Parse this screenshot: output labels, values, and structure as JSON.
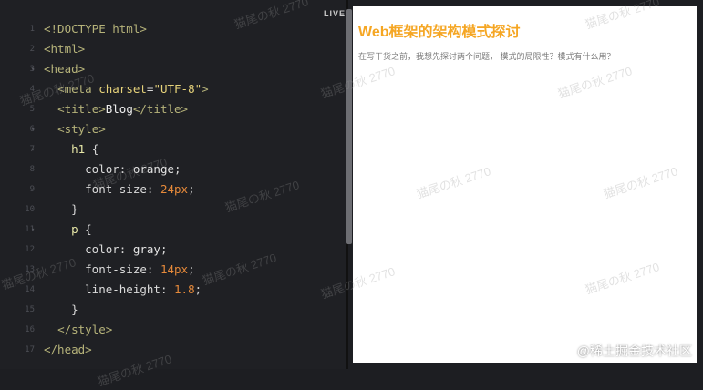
{
  "editor": {
    "live_label": "LIVE",
    "lines": [
      {
        "n": "1",
        "fold": "",
        "parts": [
          [
            "tag",
            "<!DOCTYPE html>"
          ]
        ]
      },
      {
        "n": "2",
        "fold": "",
        "parts": [
          [
            "tag",
            "<html>"
          ]
        ]
      },
      {
        "n": "3",
        "fold": "▾",
        "parts": [
          [
            "tag",
            "<head>"
          ]
        ]
      },
      {
        "n": "4",
        "fold": "",
        "parts": [
          [
            "txt",
            "  "
          ],
          [
            "tag",
            "<meta "
          ],
          [
            "attr",
            "charset"
          ],
          [
            "pun",
            "="
          ],
          [
            "str",
            "\"UTF-8\""
          ],
          [
            "tag",
            ">"
          ]
        ]
      },
      {
        "n": "5",
        "fold": "",
        "parts": [
          [
            "txt",
            "  "
          ],
          [
            "tag",
            "<title>"
          ],
          [
            "txt",
            "Blog"
          ],
          [
            "tag",
            "</title>"
          ]
        ]
      },
      {
        "n": "6",
        "fold": "▾",
        "parts": [
          [
            "txt",
            "  "
          ],
          [
            "tag",
            "<style>"
          ]
        ]
      },
      {
        "n": "7",
        "fold": "▾",
        "parts": [
          [
            "txt",
            "    "
          ],
          [
            "sel",
            "h1"
          ],
          [
            "pun",
            " {"
          ]
        ]
      },
      {
        "n": "8",
        "fold": "",
        "parts": [
          [
            "txt",
            "      "
          ],
          [
            "prop",
            "color"
          ],
          [
            "pun",
            ": "
          ],
          [
            "val",
            "orange"
          ],
          [
            "pun",
            ";"
          ]
        ]
      },
      {
        "n": "9",
        "fold": "",
        "parts": [
          [
            "txt",
            "      "
          ],
          [
            "prop",
            "font-size"
          ],
          [
            "pun",
            ": "
          ],
          [
            "num",
            "24px"
          ],
          [
            "pun",
            ";"
          ]
        ]
      },
      {
        "n": "10",
        "fold": "",
        "parts": [
          [
            "txt",
            "    "
          ],
          [
            "pun",
            "}"
          ]
        ]
      },
      {
        "n": "11",
        "fold": "▾",
        "parts": [
          [
            "txt",
            "    "
          ],
          [
            "sel",
            "p"
          ],
          [
            "pun",
            " {"
          ]
        ]
      },
      {
        "n": "12",
        "fold": "",
        "parts": [
          [
            "txt",
            "      "
          ],
          [
            "prop",
            "color"
          ],
          [
            "pun",
            ": "
          ],
          [
            "val",
            "gray"
          ],
          [
            "pun",
            ";"
          ]
        ]
      },
      {
        "n": "13",
        "fold": "",
        "parts": [
          [
            "txt",
            "      "
          ],
          [
            "prop",
            "font-size"
          ],
          [
            "pun",
            ": "
          ],
          [
            "num",
            "14px"
          ],
          [
            "pun",
            ";"
          ]
        ]
      },
      {
        "n": "14",
        "fold": "",
        "parts": [
          [
            "txt",
            "      "
          ],
          [
            "prop",
            "line-height"
          ],
          [
            "pun",
            ": "
          ],
          [
            "num",
            "1.8"
          ],
          [
            "pun",
            ";"
          ]
        ]
      },
      {
        "n": "15",
        "fold": "",
        "parts": [
          [
            "txt",
            "    "
          ],
          [
            "pun",
            "}"
          ]
        ]
      },
      {
        "n": "16",
        "fold": "",
        "parts": [
          [
            "txt",
            "  "
          ],
          [
            "tag",
            "</style>"
          ]
        ]
      },
      {
        "n": "17",
        "fold": "",
        "parts": [
          [
            "tag",
            "</head>"
          ]
        ]
      }
    ]
  },
  "preview": {
    "title": "Web框架的架构模式探讨",
    "paragraph": "在写干货之前，我想先探讨两个问题， 模式的局限性？模式有什么用？"
  },
  "watermark": {
    "text": "猫尾の秋 2770",
    "brand": "@稀土掘金技术社区"
  }
}
